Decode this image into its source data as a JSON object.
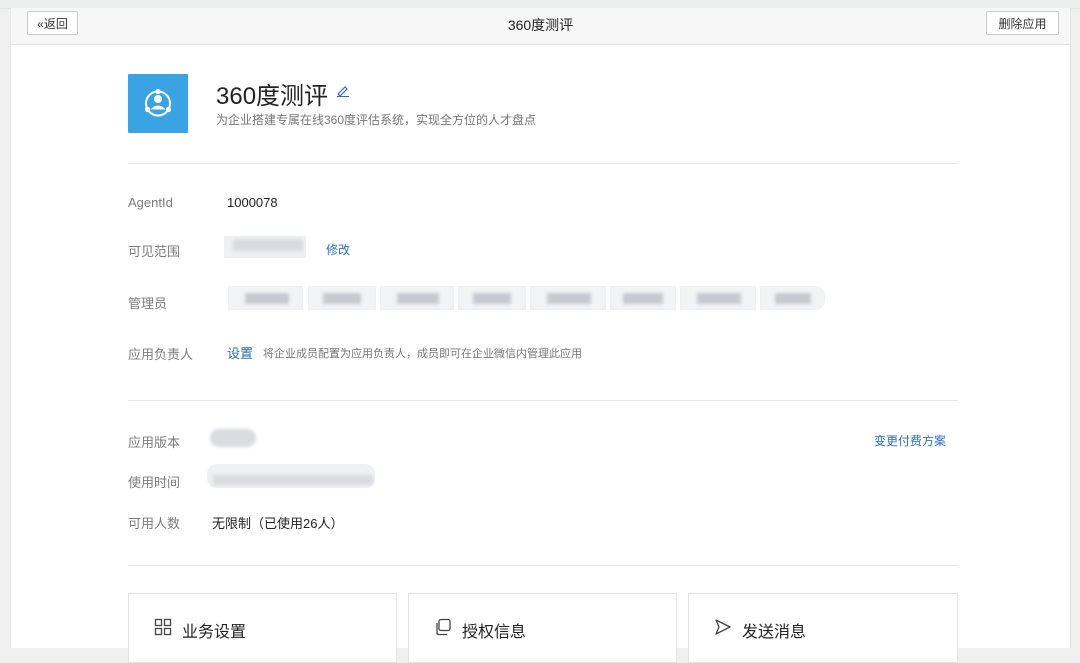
{
  "header": {
    "back_label": "«返回",
    "title": "360度测评",
    "delete_label": "删除应用"
  },
  "app": {
    "name": "360度测评",
    "description": "为企业搭建专属在线360度评估系统，实现全方位的人才盘点"
  },
  "info": {
    "agentid_label": "AgentId",
    "agentid_value": "1000078",
    "visible_scope_label": "可见范围",
    "visible_scope_edit": "修改",
    "admins_label": "管理员",
    "owner_label": "应用负责人",
    "owner_set": "设置",
    "owner_hint": "将企业成员配置为应用负责人，成员即可在企业微信内管理此应用"
  },
  "plan": {
    "version_label": "应用版本",
    "usage_time_label": "使用时间",
    "seats_label": "可用人数",
    "seats_value": "无限制（已使用26人）",
    "change_plan": "变更付费方案"
  },
  "cards": [
    {
      "label": "业务设置",
      "icon": "grid-icon"
    },
    {
      "label": "授权信息",
      "icon": "copy-icon"
    },
    {
      "label": "发送消息",
      "icon": "send-icon"
    }
  ],
  "colors": {
    "accent": "#3aa3e3",
    "link": "#2a6fb6"
  }
}
